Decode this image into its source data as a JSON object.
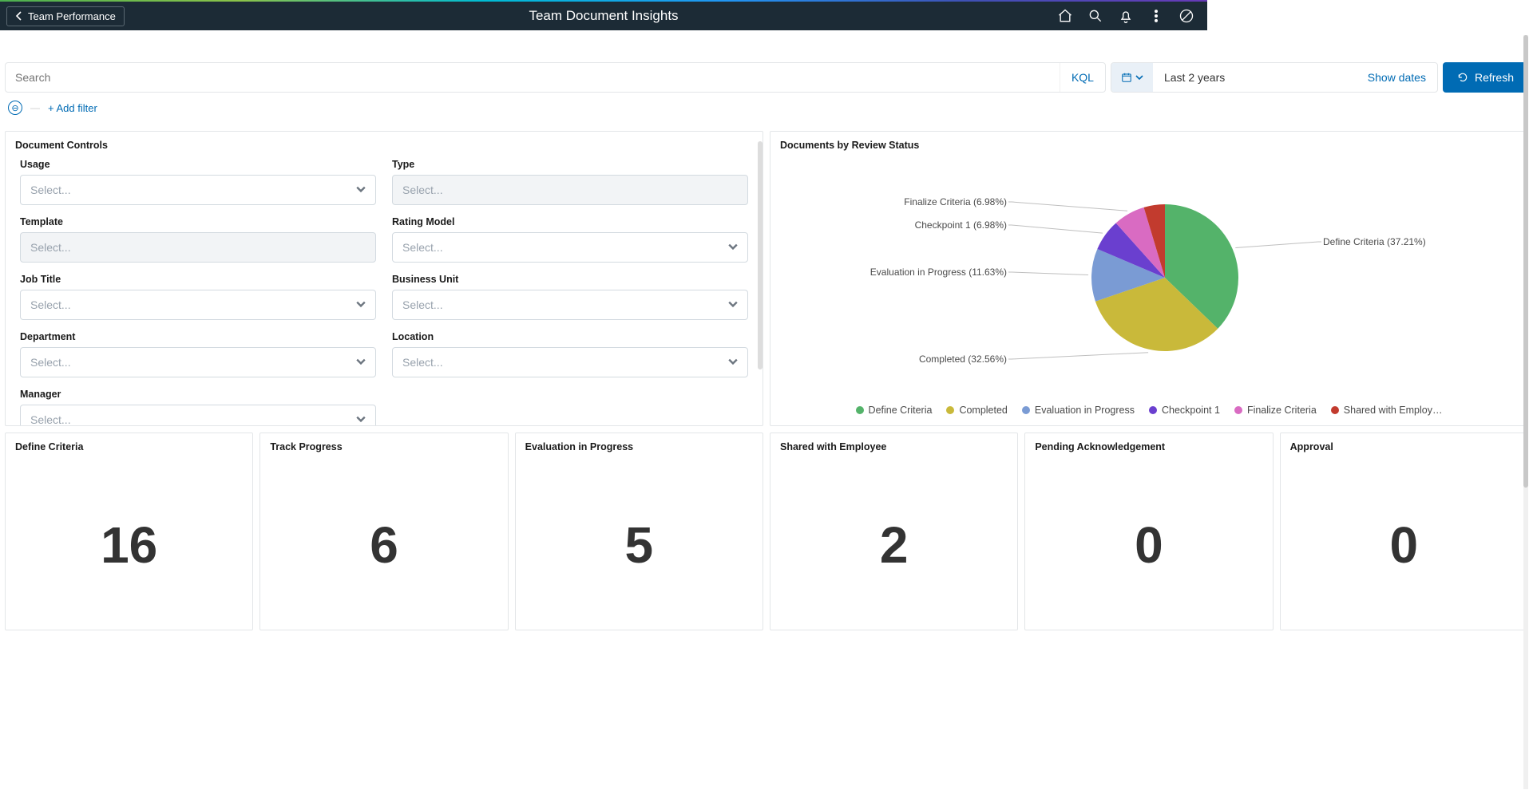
{
  "header": {
    "back_label": "Team Performance",
    "title": "Team Document Insights"
  },
  "filterbar": {
    "search_placeholder": "Search",
    "kql_label": "KQL",
    "date_range_text": "Last 2 years",
    "show_dates_label": "Show dates",
    "refresh_label": "Refresh",
    "add_filter_label": "+ Add filter"
  },
  "panels": {
    "controls": {
      "title": "Document Controls",
      "fields": [
        {
          "label": "Usage",
          "placeholder": "Select...",
          "disabled": false,
          "chevron": true
        },
        {
          "label": "Type",
          "placeholder": "Select...",
          "disabled": true,
          "chevron": false
        },
        {
          "label": "Template",
          "placeholder": "Select...",
          "disabled": true,
          "chevron": false
        },
        {
          "label": "Rating Model",
          "placeholder": "Select...",
          "disabled": false,
          "chevron": true
        },
        {
          "label": "Job Title",
          "placeholder": "Select...",
          "disabled": false,
          "chevron": true
        },
        {
          "label": "Business Unit",
          "placeholder": "Select...",
          "disabled": false,
          "chevron": true
        },
        {
          "label": "Department",
          "placeholder": "Select...",
          "disabled": false,
          "chevron": true
        },
        {
          "label": "Location",
          "placeholder": "Select...",
          "disabled": false,
          "chevron": true
        },
        {
          "label": "Manager",
          "placeholder": "Select...",
          "disabled": false,
          "chevron": true
        }
      ]
    },
    "chart": {
      "title": "Documents by Review Status"
    }
  },
  "chart_data": {
    "type": "pie",
    "title": "Documents by Review Status",
    "series": [
      {
        "name": "Define Criteria",
        "value": 37.21,
        "color": "#54b36a"
      },
      {
        "name": "Completed",
        "value": 32.56,
        "color": "#c9b93a"
      },
      {
        "name": "Evaluation in Progress",
        "value": 11.63,
        "color": "#7a9bd4"
      },
      {
        "name": "Checkpoint 1",
        "value": 6.98,
        "color": "#6a3fcf"
      },
      {
        "name": "Finalize Criteria",
        "value": 6.98,
        "color": "#d96bc2"
      },
      {
        "name": "Shared with Employ…",
        "value": 4.64,
        "color": "#c23b2e"
      }
    ]
  },
  "cards": [
    {
      "title": "Define Criteria",
      "value": "16"
    },
    {
      "title": "Track Progress",
      "value": "6"
    },
    {
      "title": "Evaluation in Progress",
      "value": "5"
    },
    {
      "title": "Shared with Employee",
      "value": "2"
    },
    {
      "title": "Pending Acknowledgement",
      "value": "0"
    },
    {
      "title": "Approval",
      "value": "0"
    }
  ]
}
